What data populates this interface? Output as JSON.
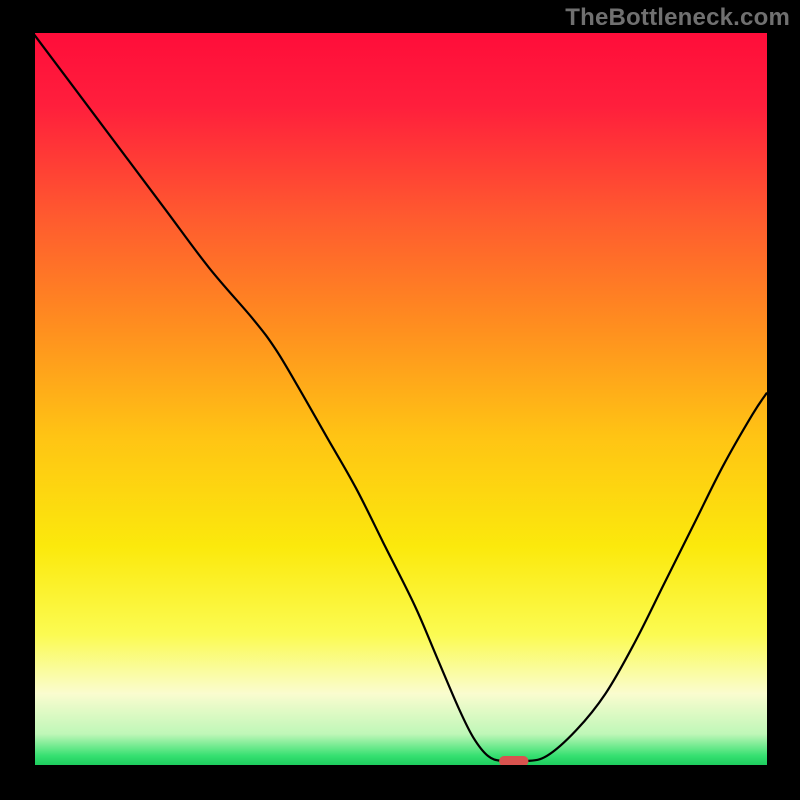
{
  "watermark": "TheBottleneck.com",
  "colors": {
    "frame": "#000000",
    "watermark": "#707070",
    "curve": "#000000",
    "marker": "#d9534f",
    "gradient_stops": [
      {
        "offset": 0.0,
        "color": "#ff0d3a"
      },
      {
        "offset": 0.1,
        "color": "#ff1f3c"
      },
      {
        "offset": 0.25,
        "color": "#ff5a2f"
      },
      {
        "offset": 0.4,
        "color": "#ff8e1f"
      },
      {
        "offset": 0.55,
        "color": "#ffc414"
      },
      {
        "offset": 0.7,
        "color": "#fbe90c"
      },
      {
        "offset": 0.82,
        "color": "#fbfb52"
      },
      {
        "offset": 0.9,
        "color": "#fafccf"
      },
      {
        "offset": 0.955,
        "color": "#bff7b8"
      },
      {
        "offset": 0.985,
        "color": "#35e070"
      },
      {
        "offset": 1.0,
        "color": "#18c85a"
      }
    ]
  },
  "chart_data": {
    "type": "line",
    "title": "",
    "xlabel": "",
    "ylabel": "",
    "xlim": [
      0,
      100
    ],
    "ylim": [
      0,
      100
    ],
    "series": [
      {
        "name": "bottleneck-curve",
        "x": [
          0,
          6,
          12,
          18,
          24,
          30,
          33,
          36,
          40,
          44,
          48,
          52,
          55,
          58,
          60,
          62,
          64,
          67,
          70,
          74,
          78,
          82,
          86,
          90,
          94,
          98,
          100
        ],
        "values": [
          100,
          92,
          84,
          76,
          68,
          61,
          57,
          52,
          45,
          38,
          30,
          22,
          15,
          8,
          4,
          1.5,
          0.8,
          0.8,
          1.5,
          5,
          10,
          17,
          25,
          33,
          41,
          48,
          51
        ]
      }
    ],
    "marker": {
      "x": 65.5,
      "y": 0.8,
      "width": 4,
      "height": 1.4
    },
    "grid": false,
    "legend": false
  }
}
